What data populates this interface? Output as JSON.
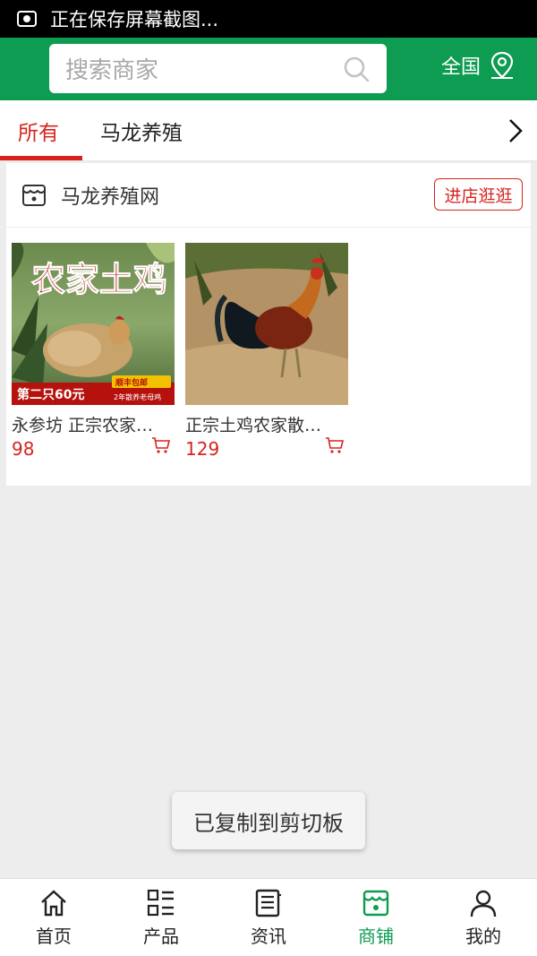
{
  "status_bar": {
    "text": "正在保存屏幕截图..."
  },
  "header": {
    "search_placeholder": "搜索商家",
    "region_label": "全国"
  },
  "tabs": [
    {
      "label": "所有",
      "active": true
    },
    {
      "label": "马龙养殖",
      "active": false
    }
  ],
  "shop": {
    "name": "马龙养殖网",
    "enter_label": "进店逛逛",
    "products": [
      {
        "name": "永参坊 正宗农家…",
        "price": "98",
        "image_text": {
          "title": "农家土鸡",
          "promo": "第二只60元",
          "badge": "顺丰包邮",
          "sub": "2年散养老母鸡"
        }
      },
      {
        "name": "正宗土鸡农家散…",
        "price": "129"
      }
    ]
  },
  "toast": "已复制到剪切板",
  "bottom_nav": [
    {
      "label": "首页",
      "icon": "home-icon",
      "active": false
    },
    {
      "label": "产品",
      "icon": "grid-list-icon",
      "active": false
    },
    {
      "label": "资讯",
      "icon": "news-icon",
      "active": false
    },
    {
      "label": "商铺",
      "icon": "store-icon",
      "active": true
    },
    {
      "label": "我的",
      "icon": "user-icon",
      "active": false
    }
  ],
  "colors": {
    "brand_green": "#0e9b52",
    "accent_red": "#d7231e"
  }
}
